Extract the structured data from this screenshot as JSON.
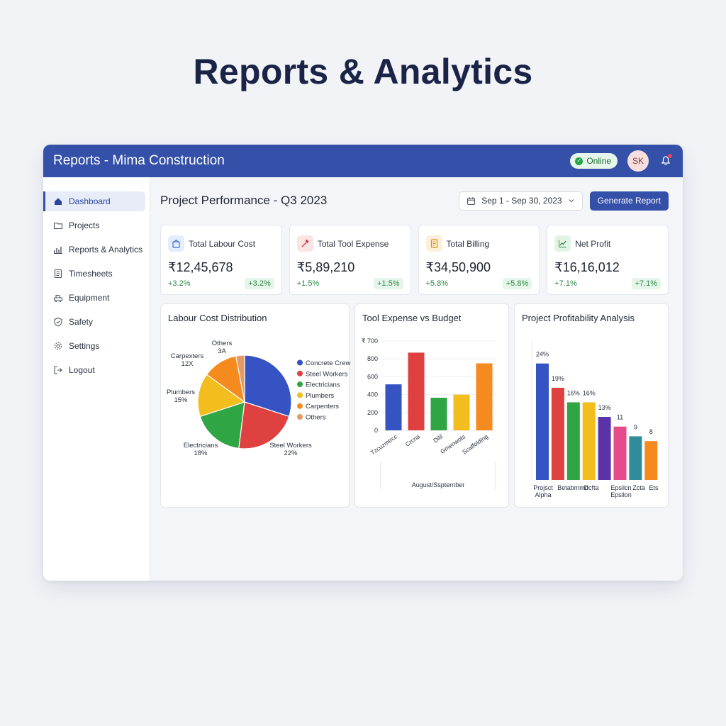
{
  "hero": {
    "title": "Reports & Analytics"
  },
  "topbar": {
    "title": "Reports - Mima Construction",
    "status": "Online",
    "avatar_initials": "SK"
  },
  "sidebar": {
    "items": [
      {
        "label": "Dashboard",
        "icon": "home-icon",
        "active": true
      },
      {
        "label": "Projects",
        "icon": "folder-icon",
        "active": false
      },
      {
        "label": "Reports & Analytics",
        "icon": "bar-chart-icon",
        "active": false
      },
      {
        "label": "Timesheets",
        "icon": "document-icon",
        "active": false
      },
      {
        "label": "Equipment",
        "icon": "equipment-icon",
        "active": false
      },
      {
        "label": "Safety",
        "icon": "shield-icon",
        "active": false
      },
      {
        "label": "Settings",
        "icon": "gear-icon",
        "active": false
      },
      {
        "label": "Logout",
        "icon": "logout-icon",
        "active": false
      }
    ]
  },
  "header": {
    "title": "Project Performance - Q3 2023",
    "date_range": "Sep 1 - Sep 30, 2023",
    "generate_label": "Generate Report"
  },
  "kpis": [
    {
      "label": "Total Labour Cost",
      "value": "₹12,45,678",
      "change": "+3.2%",
      "badge": "+3.2%",
      "icon": "labour-icon",
      "color": "#3b6fd8",
      "bg": "#e3edfb"
    },
    {
      "label": "Total Tool Expense",
      "value": "₹5,89,210",
      "change": "+1.5%",
      "badge": "+1.5%",
      "icon": "tool-icon",
      "color": "#d94747",
      "bg": "#fbe4e4"
    },
    {
      "label": "Total Billing",
      "value": "₹34,50,900",
      "change": "+5.8%",
      "badge": "+5.8%",
      "icon": "billing-icon",
      "color": "#d9911a",
      "bg": "#fcf0d8"
    },
    {
      "label": "Net Profit",
      "value": "₹16,16,012",
      "change": "+7.1%",
      "badge": "+7.1%",
      "icon": "profit-icon",
      "color": "#2f8a45",
      "bg": "#e3f4e7"
    }
  ],
  "colors": {
    "accent": "#3450a8",
    "positive": "#2f8a45"
  },
  "chart_data": [
    {
      "type": "pie",
      "title": "Labour Cost Distribution",
      "slices": [
        {
          "label": "Concrete Crew",
          "value": 30,
          "color": "#3553c2"
        },
        {
          "label": "Steel Workers",
          "value": 22,
          "color": "#df4141"
        },
        {
          "label": "Electricians",
          "value": 18,
          "color": "#2fa544"
        },
        {
          "label": "Plumbers",
          "value": 15,
          "color": "#f2bd1d"
        },
        {
          "label": "Carpenters",
          "value": 12,
          "color": "#f58a1f"
        },
        {
          "label": "Others",
          "value": 3,
          "color": "#e39a63"
        }
      ],
      "callouts": [
        {
          "label": "Others",
          "value_text": "3A"
        },
        {
          "label": "Carpexters",
          "value_text": "12X"
        },
        {
          "label": "Plumbers",
          "value_text": "15%"
        },
        {
          "label": "Electricians",
          "value_text": "18%"
        },
        {
          "label": "Steel Workers",
          "value_text": "22%"
        }
      ],
      "legend": "right"
    },
    {
      "type": "bar",
      "title": "Tool Expense vs Budget",
      "categories": [
        "Tzcuzmtrcc",
        "Crcna",
        "Dilil",
        "Gmenwots",
        "Scaffolding"
      ],
      "values": [
        515,
        870,
        365,
        400,
        750
      ],
      "colors": [
        "#3553c2",
        "#df4141",
        "#2fa544",
        "#f2bd1d",
        "#f58a1f"
      ],
      "ylim": [
        0,
        1000
      ],
      "yticks": [
        0,
        200,
        400,
        600,
        800
      ],
      "ytick_labels": [
        "0",
        "200",
        "400",
        "600",
        "800",
        "₹ 700"
      ],
      "xlabel": "August/Sspternber",
      "grid": true
    },
    {
      "type": "bar",
      "title": "Project Profitability Analysis",
      "categories": [
        "Projsct Alpha",
        "Betabmmd",
        "Dcfta",
        "",
        "Epsilcn Epsilon",
        "Zcta",
        "",
        "Ets"
      ],
      "values": [
        24,
        19,
        16,
        16,
        13,
        11,
        9,
        8
      ],
      "data_labels": [
        "24%",
        "19%",
        "16%",
        "16%",
        "13%",
        "11",
        "9",
        "8"
      ],
      "colors": [
        "#3553c2",
        "#df4141",
        "#2fa544",
        "#f2bd1d",
        "#5b33a8",
        "#e54d8a",
        "#2f8c9b",
        "#f58a1f"
      ],
      "ylim": [
        0,
        26
      ]
    }
  ]
}
